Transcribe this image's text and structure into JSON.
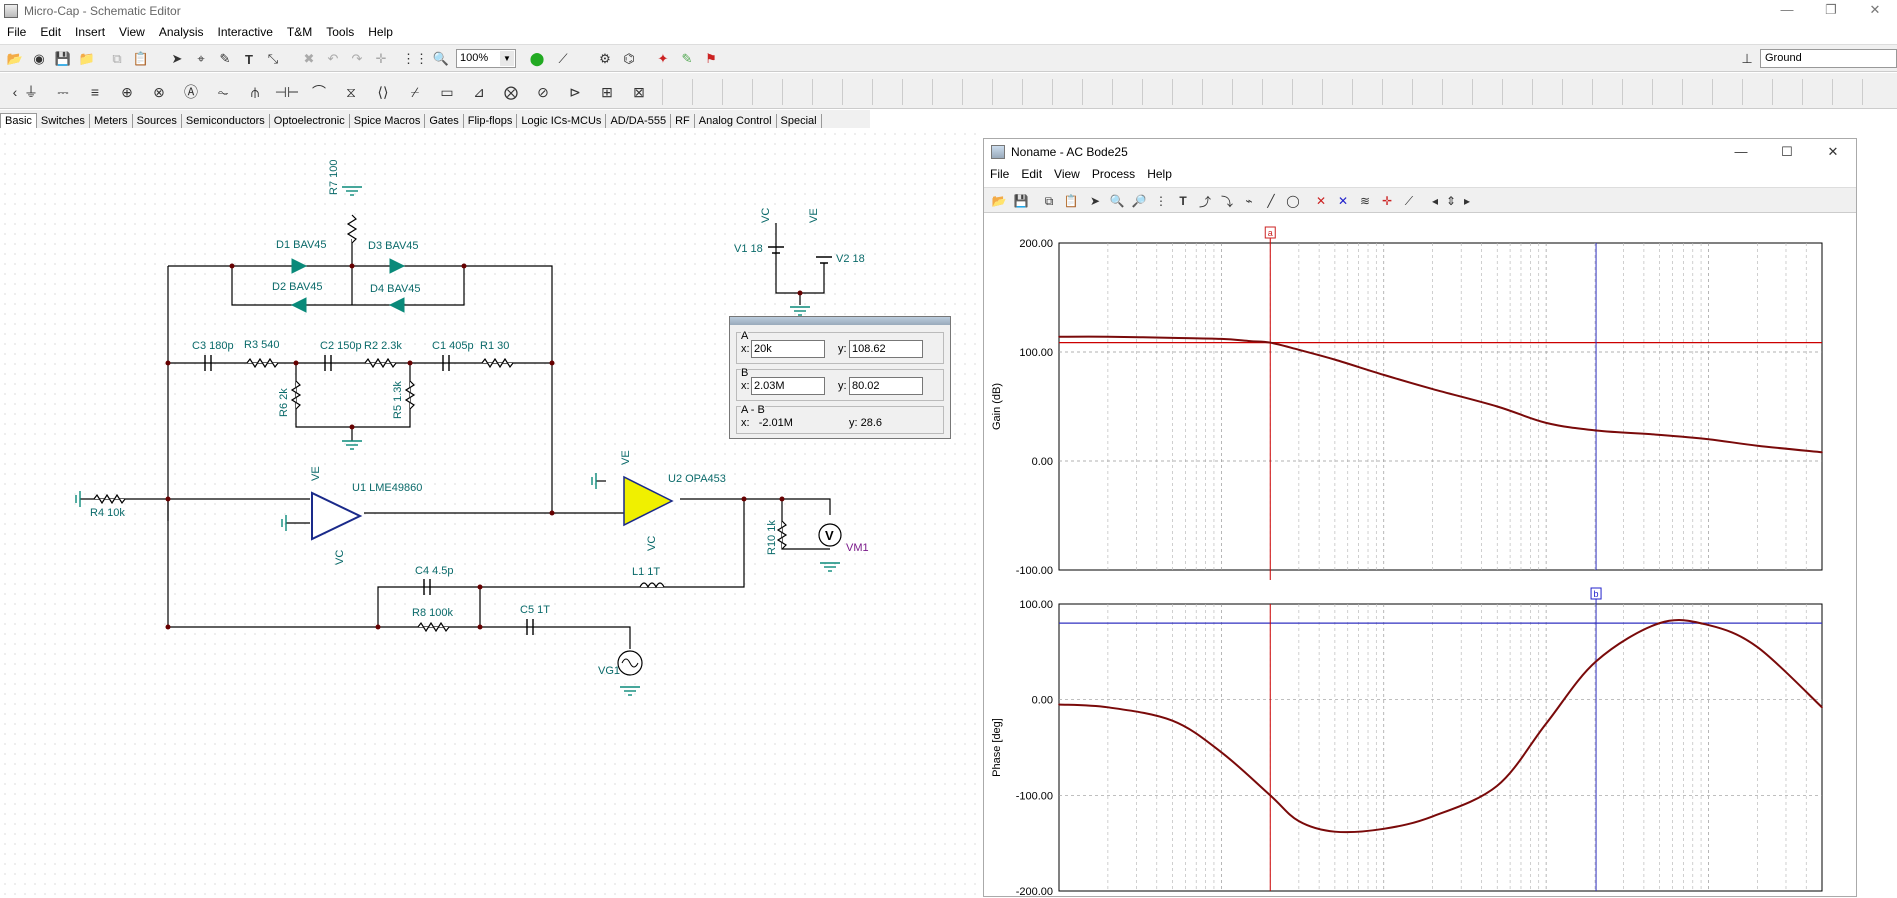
{
  "app": {
    "title": "Micro-Cap - Schematic Editor",
    "win_min": "—",
    "win_max": "❐",
    "win_close": "✕",
    "menu": [
      "File",
      "Edit",
      "Insert",
      "View",
      "Analysis",
      "Interactive",
      "T&M",
      "Tools",
      "Help"
    ]
  },
  "toolbar": {
    "zoom": "100%",
    "ground_select": "Ground"
  },
  "tabs": [
    "Basic",
    "Switches",
    "Meters",
    "Sources",
    "Semiconductors",
    "Optoelectronic",
    "Spice Macros",
    "Gates",
    "Flip-flops",
    "Logic ICs-MCUs",
    "AD/DA-555",
    "RF",
    "Analog Control",
    "Special"
  ],
  "schematic": {
    "labels": {
      "r7": "R7 100",
      "d1": "D1 BAV45",
      "d3": "D3 BAV45",
      "d2": "D2 BAV45",
      "d4": "D4 BAV45",
      "c3": "C3 180p",
      "r3": "R3 540",
      "c2": "C2 150p",
      "r2": "R2 2.3k",
      "c1": "C1 405p",
      "r1": "R1 30",
      "r6": "R6 2k",
      "r5": "R5 1.3k",
      "vc": "VC",
      "ve": "VE",
      "v1": "V1 18",
      "v2": "V2 18",
      "u1": "U1 LME49860",
      "u2": "U2 OPA453",
      "r4": "R4 10k",
      "r10": "R10 1k",
      "vm1": "VM1",
      "vm_sym": "V",
      "c4": "C4 4.5p",
      "l1": "L1 1T",
      "r8": "R8 100k",
      "c5": "C5 1T",
      "vg1": "VG1"
    }
  },
  "cursor_panel": {
    "a_label": "A",
    "a_x_label": "x:",
    "a_x": "20k",
    "a_y_label": "y:",
    "a_y": "108.62",
    "b_label": "B",
    "b_x_label": "x:",
    "b_x": "2.03M",
    "b_y_label": "y:",
    "b_y": "80.02",
    "ab_label": "A - B",
    "ab_x": "x:   -2.01M",
    "ab_y": "y: 28.6"
  },
  "bode_window": {
    "title": "Noname - AC Bode25",
    "win_min": "—",
    "win_max": "☐",
    "win_close": "✕",
    "menu": [
      "File",
      "Edit",
      "View",
      "Process",
      "Help"
    ]
  },
  "chart_data": [
    {
      "type": "line",
      "title": "",
      "xlabel": "",
      "ylabel": "Gain (dB)",
      "x_scale": "log",
      "x_unit": "Hz",
      "xlim": [
        1000,
        50000000
      ],
      "ylim": [
        -100,
        200
      ],
      "yticks": [
        "200.00",
        "100.00",
        "0.00",
        "-100.00"
      ],
      "grid": true,
      "series": [
        {
          "color": "#7a0a0a",
          "x": [
            1000,
            2000,
            5000,
            10000,
            15000,
            20000,
            30000,
            50000,
            100000,
            200000,
            500000,
            1000000,
            2030000,
            5000000,
            10000000,
            20000000,
            50000000
          ],
          "y": [
            114,
            114,
            113,
            112,
            110,
            108.6,
            102,
            93,
            79,
            66,
            50,
            35,
            28,
            24,
            20,
            14,
            8
          ]
        }
      ],
      "cursor_a": {
        "x": 20000,
        "y": 108.62,
        "color": "#cc0000"
      },
      "cursor_b": {
        "x": 2030000,
        "color": "#3030c0"
      },
      "hline": {
        "y": 108.62,
        "color": "#cc0000"
      }
    },
    {
      "type": "line",
      "title": "",
      "xlabel": "",
      "ylabel": "Phase [deg]",
      "x_scale": "log",
      "x_unit": "Hz",
      "xlim": [
        1000,
        50000000
      ],
      "ylim": [
        -200,
        100
      ],
      "yticks": [
        "100.00",
        "0.00",
        "-100.00",
        "-200.00"
      ],
      "grid": true,
      "series": [
        {
          "color": "#7a0a0a",
          "x": [
            1000,
            2000,
            5000,
            10000,
            20000,
            30000,
            50000,
            100000,
            200000,
            500000,
            1000000,
            2030000,
            5000000,
            10000000,
            20000000,
            50000000
          ],
          "y": [
            -5,
            -8,
            -22,
            -55,
            -100,
            -127,
            -138,
            -135,
            -122,
            -90,
            -25,
            40,
            80,
            78,
            55,
            -8
          ]
        }
      ],
      "cursor_b": {
        "x": 2030000,
        "y": 80.02,
        "color": "#3030c0"
      },
      "cursor_a": {
        "x": 20000,
        "color": "#cc0000"
      },
      "hline": {
        "y": 80.02,
        "color": "#3030c0"
      },
      "marker_a": "a",
      "marker_b": "b"
    }
  ]
}
